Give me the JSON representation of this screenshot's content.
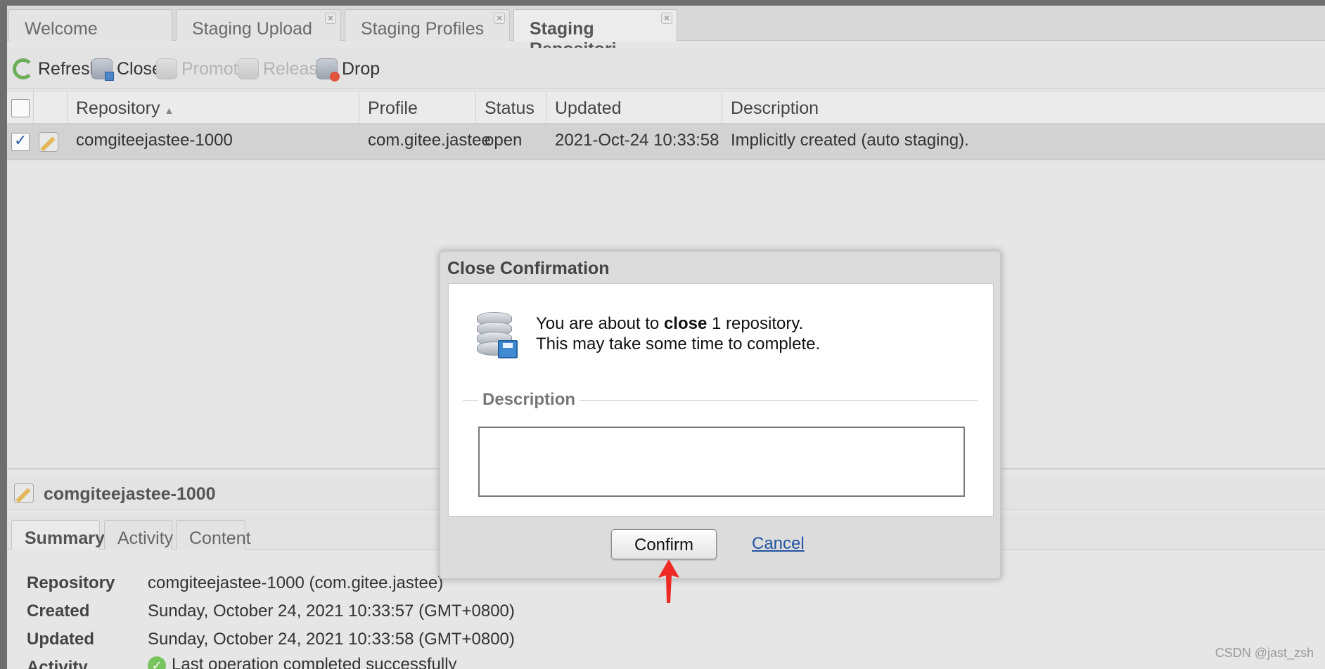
{
  "tabs": [
    {
      "label": "Welcome",
      "closable": false,
      "active": false
    },
    {
      "label": "Staging Upload",
      "closable": true,
      "active": false
    },
    {
      "label": "Staging Profiles",
      "closable": true,
      "active": false
    },
    {
      "label": "Staging Repositori",
      "closable": true,
      "active": true
    }
  ],
  "toolbar": {
    "refresh": "Refresh",
    "close": "Close",
    "promote": "Promote",
    "release": "Release",
    "drop": "Drop"
  },
  "grid": {
    "columns": [
      "Repository",
      "Profile",
      "Status",
      "Updated",
      "Description"
    ],
    "rows": [
      {
        "checked": true,
        "repository": "comgiteejastee-1000",
        "profile": "com.gitee.jastee",
        "status": "open",
        "updated": "2021-Oct-24 10:33:58",
        "description": "Implicitly created (auto staging)."
      }
    ]
  },
  "detail": {
    "title": "comgiteejastee-1000",
    "tabs": [
      "Summary",
      "Activity",
      "Content"
    ],
    "fields": [
      {
        "label": "Repository",
        "value": "comgiteejastee-1000 (com.gitee.jastee)"
      },
      {
        "label": "Created",
        "value": "Sunday, October 24, 2021 10:33:57 (GMT+0800)"
      },
      {
        "label": "Updated",
        "value": "Sunday, October 24, 2021 10:33:58 (GMT+0800)"
      },
      {
        "label": "Activity",
        "value": "Last operation completed successfully"
      }
    ]
  },
  "dialog": {
    "title": "Close Confirmation",
    "msg_prefix": "You are about to ",
    "msg_action": "close",
    "msg_suffix": " 1 repository.",
    "msg_line2": "This may take some time to complete.",
    "description_legend": "Description",
    "description_value": "",
    "confirm": "Confirm",
    "cancel": "Cancel"
  },
  "watermark": "CSDN @jast_zsh",
  "colors": {
    "accent_link": "#2152a3",
    "annotation_arrow": "#ee2a24"
  }
}
